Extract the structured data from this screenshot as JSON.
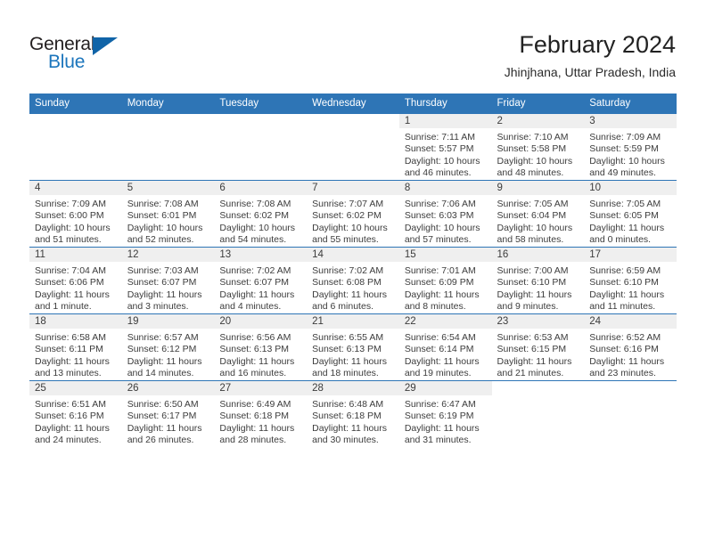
{
  "brand": {
    "name_part1": "General",
    "name_part2": "Blue",
    "triangle_icon": "triangle-right-icon",
    "accent_color": "#1b75bc",
    "header_color": "#2e75b6"
  },
  "header": {
    "month_title": "February 2024",
    "location": "Jhinjhana, Uttar Pradesh, India"
  },
  "weekday_headers": [
    "Sunday",
    "Monday",
    "Tuesday",
    "Wednesday",
    "Thursday",
    "Friday",
    "Saturday"
  ],
  "weeks": [
    [
      {
        "day": "",
        "lines": []
      },
      {
        "day": "",
        "lines": []
      },
      {
        "day": "",
        "lines": []
      },
      {
        "day": "",
        "lines": []
      },
      {
        "day": "1",
        "lines": [
          "Sunrise: 7:11 AM",
          "Sunset: 5:57 PM",
          "Daylight: 10 hours",
          "and 46 minutes."
        ]
      },
      {
        "day": "2",
        "lines": [
          "Sunrise: 7:10 AM",
          "Sunset: 5:58 PM",
          "Daylight: 10 hours",
          "and 48 minutes."
        ]
      },
      {
        "day": "3",
        "lines": [
          "Sunrise: 7:09 AM",
          "Sunset: 5:59 PM",
          "Daylight: 10 hours",
          "and 49 minutes."
        ]
      }
    ],
    [
      {
        "day": "4",
        "lines": [
          "Sunrise: 7:09 AM",
          "Sunset: 6:00 PM",
          "Daylight: 10 hours",
          "and 51 minutes."
        ]
      },
      {
        "day": "5",
        "lines": [
          "Sunrise: 7:08 AM",
          "Sunset: 6:01 PM",
          "Daylight: 10 hours",
          "and 52 minutes."
        ]
      },
      {
        "day": "6",
        "lines": [
          "Sunrise: 7:08 AM",
          "Sunset: 6:02 PM",
          "Daylight: 10 hours",
          "and 54 minutes."
        ]
      },
      {
        "day": "7",
        "lines": [
          "Sunrise: 7:07 AM",
          "Sunset: 6:02 PM",
          "Daylight: 10 hours",
          "and 55 minutes."
        ]
      },
      {
        "day": "8",
        "lines": [
          "Sunrise: 7:06 AM",
          "Sunset: 6:03 PM",
          "Daylight: 10 hours",
          "and 57 minutes."
        ]
      },
      {
        "day": "9",
        "lines": [
          "Sunrise: 7:05 AM",
          "Sunset: 6:04 PM",
          "Daylight: 10 hours",
          "and 58 minutes."
        ]
      },
      {
        "day": "10",
        "lines": [
          "Sunrise: 7:05 AM",
          "Sunset: 6:05 PM",
          "Daylight: 11 hours",
          "and 0 minutes."
        ]
      }
    ],
    [
      {
        "day": "11",
        "lines": [
          "Sunrise: 7:04 AM",
          "Sunset: 6:06 PM",
          "Daylight: 11 hours",
          "and 1 minute."
        ]
      },
      {
        "day": "12",
        "lines": [
          "Sunrise: 7:03 AM",
          "Sunset: 6:07 PM",
          "Daylight: 11 hours",
          "and 3 minutes."
        ]
      },
      {
        "day": "13",
        "lines": [
          "Sunrise: 7:02 AM",
          "Sunset: 6:07 PM",
          "Daylight: 11 hours",
          "and 4 minutes."
        ]
      },
      {
        "day": "14",
        "lines": [
          "Sunrise: 7:02 AM",
          "Sunset: 6:08 PM",
          "Daylight: 11 hours",
          "and 6 minutes."
        ]
      },
      {
        "day": "15",
        "lines": [
          "Sunrise: 7:01 AM",
          "Sunset: 6:09 PM",
          "Daylight: 11 hours",
          "and 8 minutes."
        ]
      },
      {
        "day": "16",
        "lines": [
          "Sunrise: 7:00 AM",
          "Sunset: 6:10 PM",
          "Daylight: 11 hours",
          "and 9 minutes."
        ]
      },
      {
        "day": "17",
        "lines": [
          "Sunrise: 6:59 AM",
          "Sunset: 6:10 PM",
          "Daylight: 11 hours",
          "and 11 minutes."
        ]
      }
    ],
    [
      {
        "day": "18",
        "lines": [
          "Sunrise: 6:58 AM",
          "Sunset: 6:11 PM",
          "Daylight: 11 hours",
          "and 13 minutes."
        ]
      },
      {
        "day": "19",
        "lines": [
          "Sunrise: 6:57 AM",
          "Sunset: 6:12 PM",
          "Daylight: 11 hours",
          "and 14 minutes."
        ]
      },
      {
        "day": "20",
        "lines": [
          "Sunrise: 6:56 AM",
          "Sunset: 6:13 PM",
          "Daylight: 11 hours",
          "and 16 minutes."
        ]
      },
      {
        "day": "21",
        "lines": [
          "Sunrise: 6:55 AM",
          "Sunset: 6:13 PM",
          "Daylight: 11 hours",
          "and 18 minutes."
        ]
      },
      {
        "day": "22",
        "lines": [
          "Sunrise: 6:54 AM",
          "Sunset: 6:14 PM",
          "Daylight: 11 hours",
          "and 19 minutes."
        ]
      },
      {
        "day": "23",
        "lines": [
          "Sunrise: 6:53 AM",
          "Sunset: 6:15 PM",
          "Daylight: 11 hours",
          "and 21 minutes."
        ]
      },
      {
        "day": "24",
        "lines": [
          "Sunrise: 6:52 AM",
          "Sunset: 6:16 PM",
          "Daylight: 11 hours",
          "and 23 minutes."
        ]
      }
    ],
    [
      {
        "day": "25",
        "lines": [
          "Sunrise: 6:51 AM",
          "Sunset: 6:16 PM",
          "Daylight: 11 hours",
          "and 24 minutes."
        ]
      },
      {
        "day": "26",
        "lines": [
          "Sunrise: 6:50 AM",
          "Sunset: 6:17 PM",
          "Daylight: 11 hours",
          "and 26 minutes."
        ]
      },
      {
        "day": "27",
        "lines": [
          "Sunrise: 6:49 AM",
          "Sunset: 6:18 PM",
          "Daylight: 11 hours",
          "and 28 minutes."
        ]
      },
      {
        "day": "28",
        "lines": [
          "Sunrise: 6:48 AM",
          "Sunset: 6:18 PM",
          "Daylight: 11 hours",
          "and 30 minutes."
        ]
      },
      {
        "day": "29",
        "lines": [
          "Sunrise: 6:47 AM",
          "Sunset: 6:19 PM",
          "Daylight: 11 hours",
          "and 31 minutes."
        ]
      },
      {
        "day": "",
        "lines": []
      },
      {
        "day": "",
        "lines": []
      }
    ]
  ]
}
